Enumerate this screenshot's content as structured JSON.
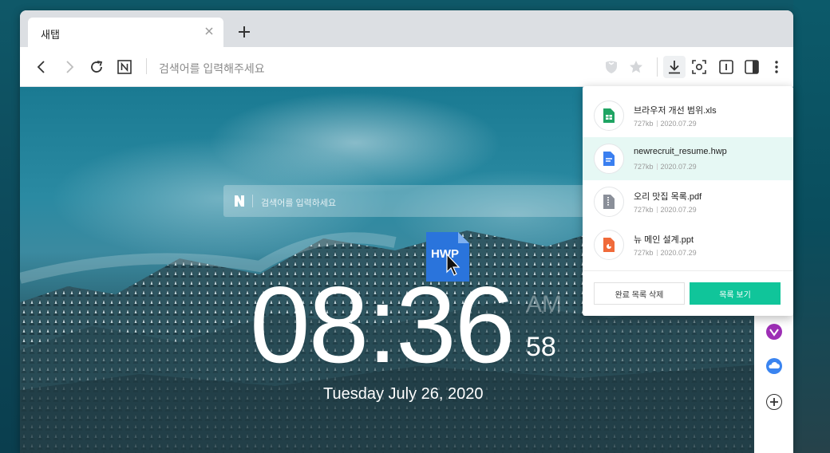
{
  "browser": {
    "tab": {
      "title": "새탭"
    },
    "address": {
      "placeholder": "검색어를 입력해주세요"
    },
    "toolbar_icons": [
      "back-icon",
      "forward-icon",
      "reload-icon",
      "naver-home-icon",
      "shield-icon",
      "star-icon",
      "download-icon",
      "capture-icon",
      "sidebar-toggle-icon",
      "split-view-icon",
      "more-icon"
    ]
  },
  "newtab": {
    "search_placeholder": "검색어를 입력하세요",
    "search_logo": "N",
    "dragged_file_label": "HWP",
    "clock": {
      "time": "08:36",
      "ampm": "AM",
      "seconds": "58"
    },
    "date": "Tuesday July 26, 2020"
  },
  "downloads": {
    "items": [
      {
        "name": "브라우저 개선 범위.xls",
        "size": "727kb",
        "date": "2020.07.29",
        "icon": "sheet-file-icon",
        "color": "#1fa463"
      },
      {
        "name": "newrecruit_resume.hwp",
        "size": "727kb",
        "date": "2020.07.29",
        "icon": "doc-file-icon",
        "color": "#3a7ff0"
      },
      {
        "name": "오리 맛집 목록.pdf",
        "size": "727kb",
        "date": "2020.07.29",
        "icon": "zip-file-icon",
        "color": "#8a8f99"
      },
      {
        "name": "뉴 메인 설계.ppt",
        "size": "727kb",
        "date": "2020.07.29",
        "icon": "slide-file-icon",
        "color": "#f06a3a"
      }
    ],
    "clear_label": "완료 목록 삭제",
    "list_label": "목록 보기",
    "accent": "#10c59a"
  }
}
